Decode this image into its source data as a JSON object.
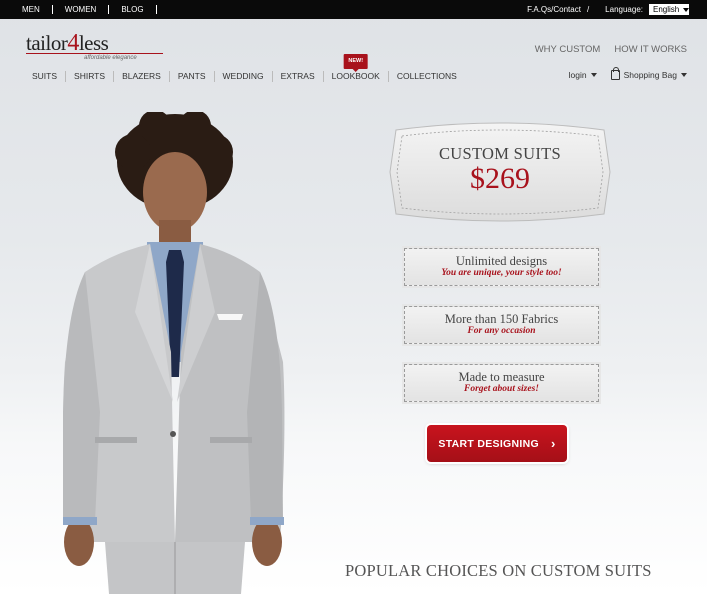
{
  "topbar": {
    "links": [
      "MEN",
      "WOMEN",
      "BLOG"
    ],
    "faq_contact": "F.A.Qs/Contact",
    "separator": "/",
    "language_label": "Language:",
    "language_value": "English"
  },
  "header": {
    "logo_text_a": "tailor",
    "logo_text_4": "4",
    "logo_text_b": "less",
    "logo_tagline": "affordable elegance",
    "top_links": [
      "WHY CUSTOM",
      "HOW IT WORKS"
    ]
  },
  "nav": {
    "items": [
      "SUITS",
      "SHIRTS",
      "BLAZERS",
      "PANTS",
      "WEDDING",
      "EXTRAS",
      "LOOKBOOK",
      "COLLECTIONS"
    ],
    "new_badge": "NEW!"
  },
  "account": {
    "login": "login",
    "bag": "Shopping Bag"
  },
  "hero": {
    "title": "CUSTOM SUITS",
    "price": "$269",
    "features": [
      {
        "heading": "Unlimited designs",
        "sub": "You are unique, your style too!"
      },
      {
        "heading": "More than 150 Fabrics",
        "sub": "For any occasion"
      },
      {
        "heading": "Made to measure",
        "sub": "Forget about sizes!"
      }
    ],
    "cta": "START DESIGNING",
    "cta_icon": "chevron-right-icon"
  },
  "section_title": "POPULAR CHOICES ON CUSTOM SUITS",
  "colors": {
    "brand_red": "#a8121c",
    "topbar": "#0a0a0a"
  }
}
